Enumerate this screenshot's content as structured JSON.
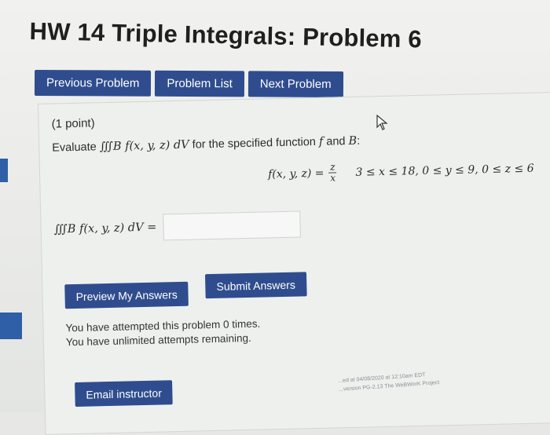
{
  "header": {
    "title": "HW 14 Triple Integrals: Problem 6"
  },
  "nav": {
    "previous_label": "Previous Problem",
    "list_label": "Problem List",
    "next_label": "Next Problem"
  },
  "problem": {
    "points": "(1 point)",
    "evaluate_prefix": "Evaluate",
    "integral_expr": "∭B f(x, y, z) dV",
    "evaluate_suffix": "for the specified function",
    "f_symbol": "f",
    "and_text": "and",
    "B_symbol": "B",
    "colon": ":",
    "function_lhs": "f(x, y, z) =",
    "frac_num": "z",
    "frac_den": "x",
    "bounds": "3 ≤ x ≤ 18, 0 ≤ y ≤ 9, 0 ≤ z ≤ 6",
    "answer_label": "∭B f(x, y, z) dV =",
    "answer_value": ""
  },
  "actions": {
    "preview_label": "Preview My Answers",
    "submit_label": "Submit Answers"
  },
  "attempts": {
    "line1": "You have attempted this problem 0 times.",
    "line2": "You have unlimited attempts remaining."
  },
  "email": {
    "label": "Email instructor"
  },
  "footer": {
    "line1": "...ed at 04/08/2020 at 12:10am EDT",
    "line2": "...version PG-2.13 The WeBWorK Project"
  },
  "colors": {
    "button_bg": "#2f4d8e",
    "button_text": "#ffffff",
    "page_bg": "#e7e8e6"
  },
  "icons": {
    "cursor": "mouse-pointer-icon"
  }
}
